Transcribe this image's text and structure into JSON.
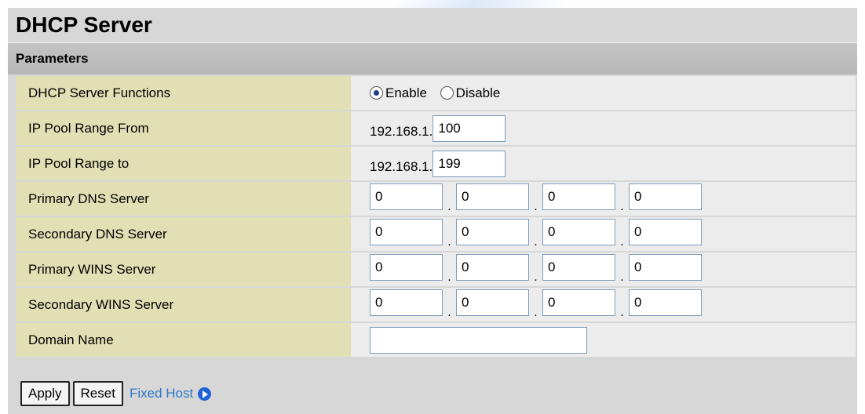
{
  "page_title": "DHCP Server",
  "section_title": "Parameters",
  "dhcp_functions": {
    "label": "DHCP Server Functions",
    "options": [
      "Enable",
      "Disable"
    ],
    "selected": "Enable"
  },
  "ip_pool_from": {
    "label": "IP Pool Range From",
    "prefix": "192.168.1.",
    "value": "100"
  },
  "ip_pool_to": {
    "label": "IP Pool Range to",
    "prefix": "192.168.1.",
    "value": "199"
  },
  "servers": [
    {
      "label": "Primary DNS Server",
      "octets": [
        "0",
        "0",
        "0",
        "0"
      ]
    },
    {
      "label": "Secondary DNS Server",
      "octets": [
        "0",
        "0",
        "0",
        "0"
      ]
    },
    {
      "label": "Primary WINS Server",
      "octets": [
        "0",
        "0",
        "0",
        "0"
      ]
    },
    {
      "label": "Secondary WINS Server",
      "octets": [
        "0",
        "0",
        "0",
        "0"
      ]
    }
  ],
  "domain_name": {
    "label": "Domain Name",
    "value": ""
  },
  "ip_separator": ".",
  "actions": {
    "apply_label": "Apply",
    "reset_label": "Reset",
    "fixed_host_label": "Fixed Host",
    "fixed_host_icon": "arrow-right-circle-icon"
  }
}
